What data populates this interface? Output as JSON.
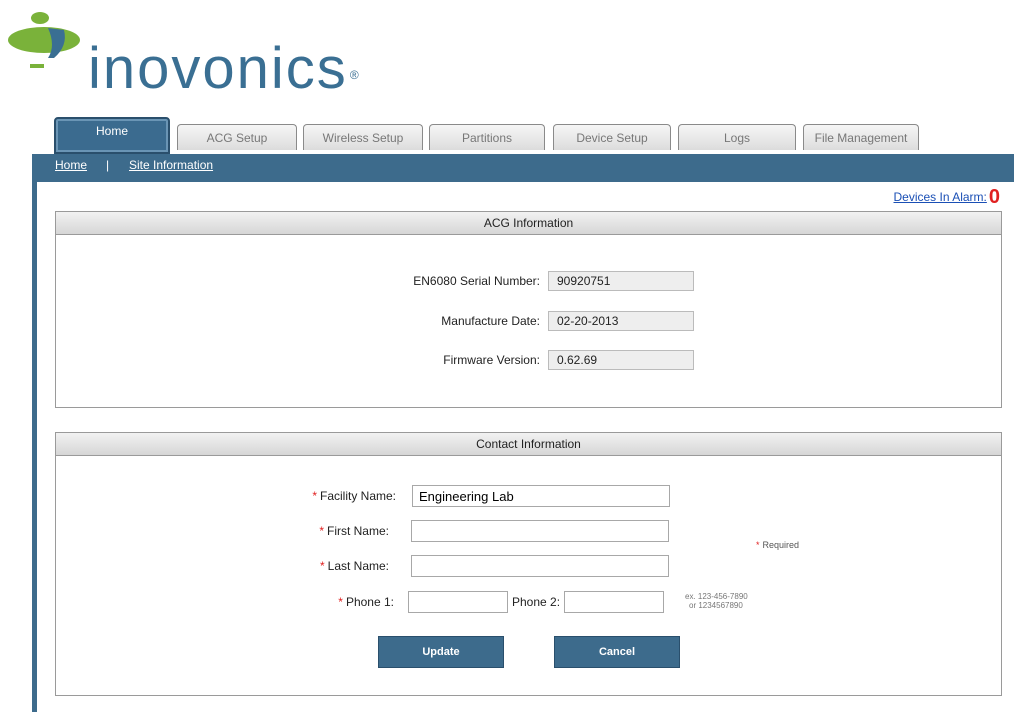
{
  "logo": {
    "text": "inovonics",
    "reg": "®",
    "icon": "inovonics-logo-icon"
  },
  "tabs": [
    {
      "label": "Home"
    },
    {
      "label": "ACG Setup"
    },
    {
      "label": "Wireless Setup"
    },
    {
      "label": "Partitions"
    },
    {
      "label": "Device Setup"
    },
    {
      "label": "Logs"
    },
    {
      "label": "File Management"
    }
  ],
  "breadcrumb": {
    "home": "Home",
    "separator": "|",
    "current": "Site Information"
  },
  "alarm": {
    "label": "Devices In Alarm:",
    "count": "0"
  },
  "acg": {
    "title": "ACG Information",
    "serial_label": "EN6080 Serial Number:",
    "serial_value": "90920751",
    "date_label": "Manufacture Date:",
    "date_value": "02-20-2013",
    "firmware_label": "Firmware Version:",
    "firmware_value": "0.62.69"
  },
  "contact": {
    "title": "Contact Information",
    "required_mark": "*",
    "facility_label": "Facility Name:",
    "facility_value": "Engineering Lab",
    "first_label": "First Name:",
    "first_value": "",
    "last_label": "Last Name:",
    "last_value": "",
    "phone1_label": "Phone 1:",
    "phone1_value": "",
    "phone2_label": "Phone 2:",
    "phone2_value": "",
    "required_note": "Required",
    "phone_hint_1": "ex. 123-456-7890",
    "phone_hint_2": "or 1234567890",
    "update_label": "Update",
    "cancel_label": "Cancel"
  },
  "colors": {
    "nav": "#3d6b8c",
    "alarm_count": "#e02020",
    "logo_blue": "#3a6f93",
    "logo_green": "#7ab23a"
  }
}
